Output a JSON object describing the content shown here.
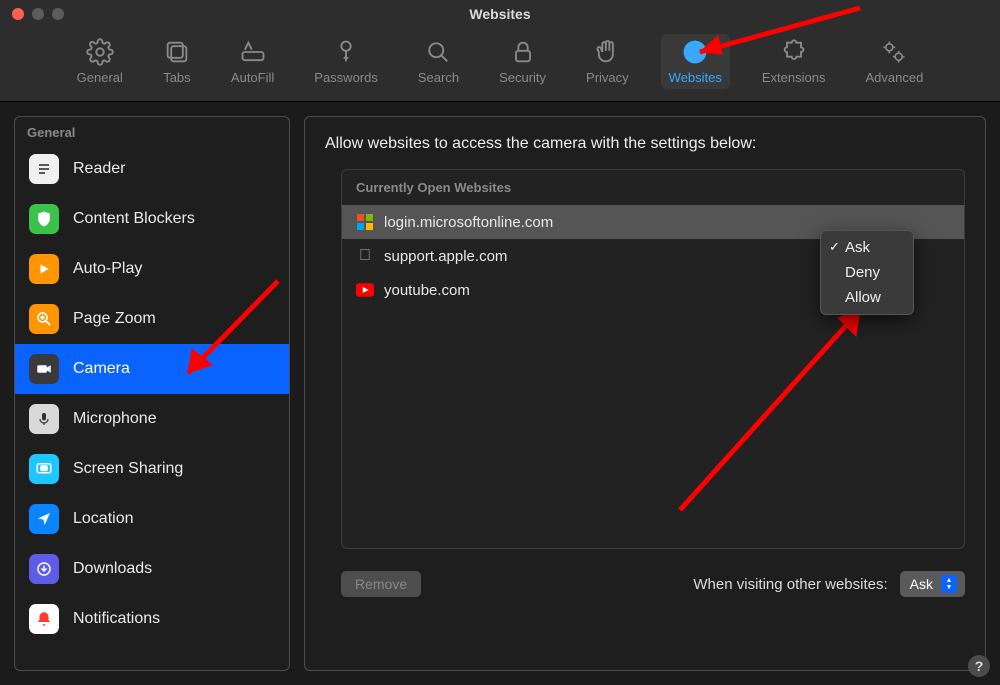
{
  "window": {
    "title": "Websites"
  },
  "toolbar": {
    "items": [
      {
        "label": "General"
      },
      {
        "label": "Tabs"
      },
      {
        "label": "AutoFill"
      },
      {
        "label": "Passwords"
      },
      {
        "label": "Search"
      },
      {
        "label": "Security"
      },
      {
        "label": "Privacy"
      },
      {
        "label": "Websites"
      },
      {
        "label": "Extensions"
      },
      {
        "label": "Advanced"
      }
    ],
    "active_index": 7
  },
  "sidebar": {
    "header": "General",
    "items": [
      {
        "label": "Reader"
      },
      {
        "label": "Content Blockers"
      },
      {
        "label": "Auto-Play"
      },
      {
        "label": "Page Zoom"
      },
      {
        "label": "Camera"
      },
      {
        "label": "Microphone"
      },
      {
        "label": "Screen Sharing"
      },
      {
        "label": "Location"
      },
      {
        "label": "Downloads"
      },
      {
        "label": "Notifications"
      }
    ],
    "selected_index": 4
  },
  "main": {
    "headline": "Allow websites to access the camera with the settings below:",
    "list_title": "Currently Open Websites",
    "sites": [
      {
        "host": "login.microsoftonline.com",
        "icon": "microsoft"
      },
      {
        "host": "support.apple.com",
        "icon": "apple"
      },
      {
        "host": "youtube.com",
        "icon": "youtube"
      }
    ],
    "selected_site_index": 0,
    "remove_label": "Remove",
    "other_label": "When visiting other websites:",
    "other_value": "Ask"
  },
  "popup": {
    "items": [
      "Ask",
      "Deny",
      "Allow"
    ],
    "checked_index": 0
  },
  "help": {
    "symbol": "?"
  }
}
